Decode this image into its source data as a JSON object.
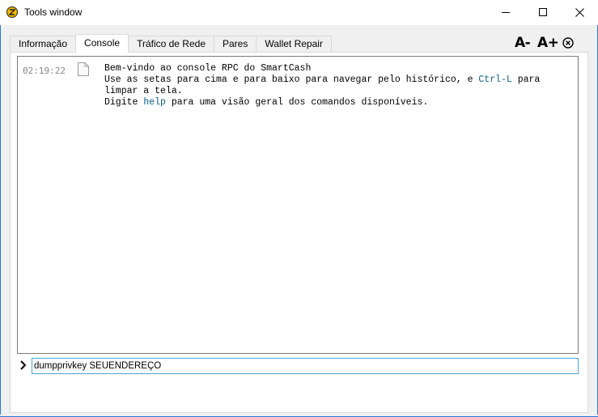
{
  "window": {
    "title": "Tools window",
    "controls": {
      "minimize": "minimize-icon",
      "maximize": "maximize-icon",
      "close": "close-icon"
    }
  },
  "tabs": [
    {
      "label": "Informação",
      "active": false
    },
    {
      "label": "Console",
      "active": true
    },
    {
      "label": "Tráfico de Rede",
      "active": false
    },
    {
      "label": "Pares",
      "active": false
    },
    {
      "label": "Wallet Repair",
      "active": false
    }
  ],
  "toolbar": {
    "font_decrease_label": "A-",
    "font_increase_label": "A+",
    "clear_icon": "clear-circle-icon"
  },
  "console": {
    "messages": [
      {
        "time": "02:19:22",
        "icon": "document-icon",
        "line1": "Bem-vindo ao console RPC do SmartCash",
        "line2_a": "Use as setas para cima e para baixo para navegar pelo histórico, e ",
        "line2_kw": "Ctrl-L",
        "line2_b": " para",
        "line3": "limpar a tela.",
        "line4_a": "Digite ",
        "line4_kw": "help",
        "line4_b": " para uma visão geral dos comandos disponíveis."
      }
    ],
    "prompt_icon": "chevron-right-icon",
    "input_value": "dumpprivkey SEUENDEREÇO"
  },
  "colors": {
    "accent_border": "#2b78d6",
    "keyword": "#0a5e8a",
    "timestamp": "#888888",
    "app_icon": "#f5b800"
  }
}
